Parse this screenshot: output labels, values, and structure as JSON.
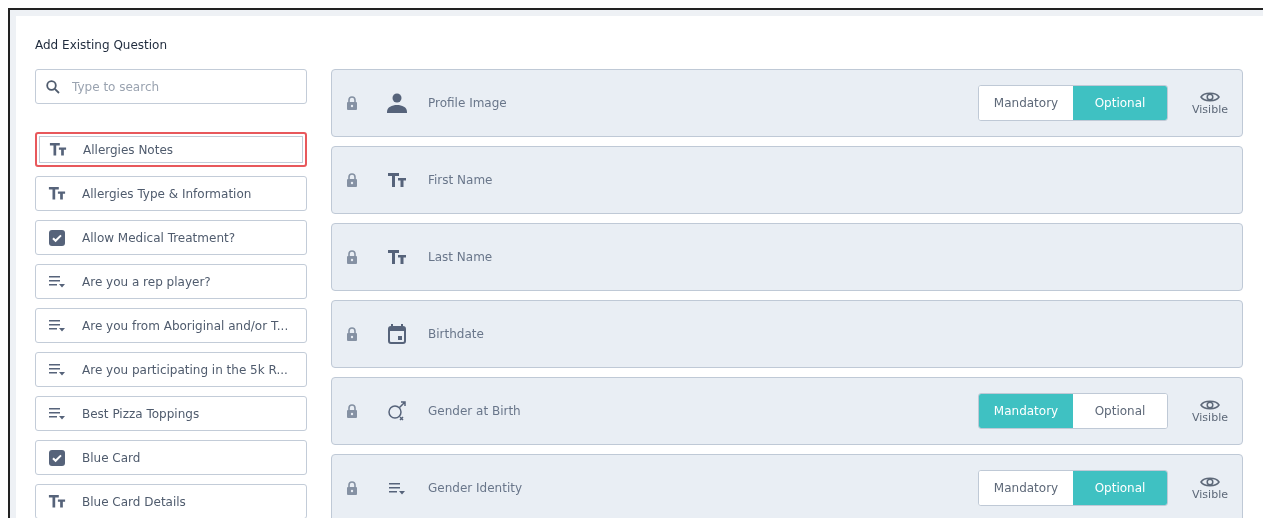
{
  "panel": {
    "title": "Add Existing Question"
  },
  "search": {
    "placeholder": "Type to search"
  },
  "questions": [
    {
      "label": "Allergies Notes",
      "kind": "text",
      "highlighted": true
    },
    {
      "label": "Allergies Type & Information",
      "kind": "text",
      "highlighted": false
    },
    {
      "label": "Allow Medical Treatment?",
      "kind": "checkbox",
      "highlighted": false
    },
    {
      "label": "Are you a rep player?",
      "kind": "dropdown",
      "highlighted": false
    },
    {
      "label": "Are you from Aboriginal and/or T...",
      "kind": "dropdown",
      "highlighted": false
    },
    {
      "label": "Are you participating in the 5k R...",
      "kind": "dropdown",
      "highlighted": false
    },
    {
      "label": "Best Pizza Toppings",
      "kind": "dropdown",
      "highlighted": false
    },
    {
      "label": "Blue Card",
      "kind": "checkbox",
      "highlighted": false
    },
    {
      "label": "Blue Card Details",
      "kind": "text",
      "highlighted": false
    }
  ],
  "fields": [
    {
      "label": "Profile Image",
      "kind": "person",
      "locked": true,
      "options": [
        {
          "label": "Mandatory",
          "selected": false
        },
        {
          "label": "Optional",
          "selected": true
        }
      ],
      "visibility": "Visible"
    },
    {
      "label": "First Name",
      "kind": "text",
      "locked": true
    },
    {
      "label": "Last Name",
      "kind": "text",
      "locked": true
    },
    {
      "label": "Birthdate",
      "kind": "calendar",
      "locked": true
    },
    {
      "label": "Gender at Birth",
      "kind": "gender",
      "locked": true,
      "options": [
        {
          "label": "Mandatory",
          "selected": true
        },
        {
          "label": "Optional",
          "selected": false
        }
      ],
      "visibility": "Visible"
    },
    {
      "label": "Gender Identity",
      "kind": "dropdown",
      "locked": true,
      "options": [
        {
          "label": "Mandatory",
          "selected": false
        },
        {
          "label": "Optional",
          "selected": true
        }
      ],
      "visibility": "Visible"
    }
  ]
}
